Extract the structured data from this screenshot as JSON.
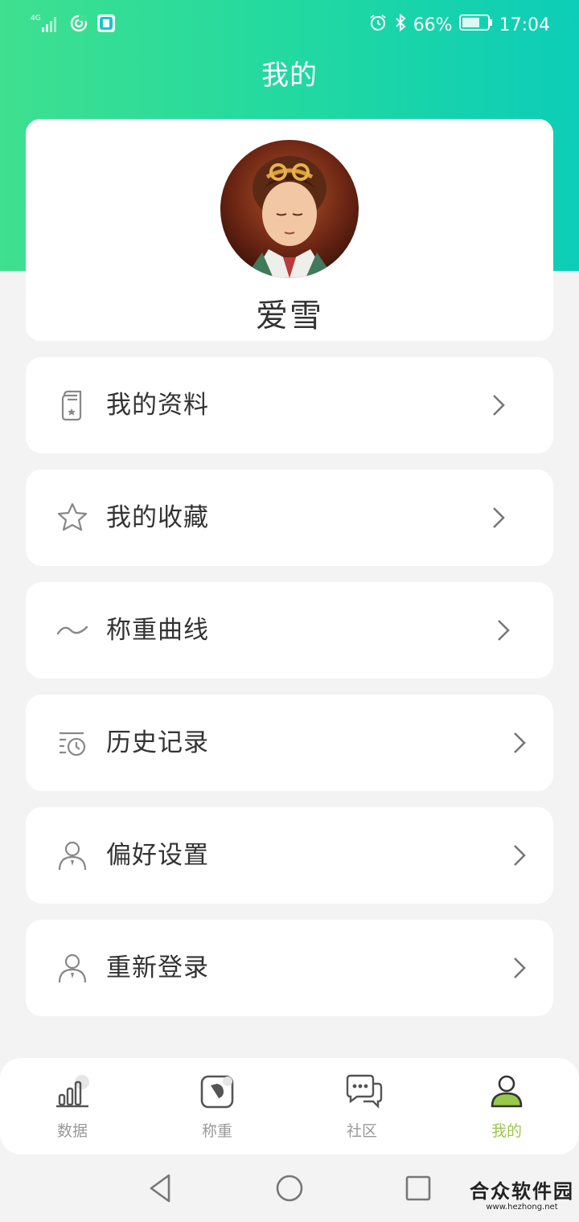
{
  "status_bar": {
    "network": "4G",
    "battery": "66%",
    "time": "17:04"
  },
  "header": {
    "title": "我的"
  },
  "profile": {
    "username": "爱雪"
  },
  "menu": [
    {
      "label": "我的资料",
      "icon": "profile-card-icon"
    },
    {
      "label": "我的收藏",
      "icon": "star-icon"
    },
    {
      "label": "称重曲线",
      "icon": "wave-curve-icon"
    },
    {
      "label": "历史记录",
      "icon": "history-clock-icon"
    },
    {
      "label": "偏好设置",
      "icon": "user-icon"
    },
    {
      "label": "重新登录",
      "icon": "user-icon"
    }
  ],
  "bottom_nav": [
    {
      "label": "数据",
      "icon": "bar-chart-icon",
      "active": false
    },
    {
      "label": "称重",
      "icon": "scale-icon",
      "active": false
    },
    {
      "label": "社区",
      "icon": "chat-bubbles-icon",
      "active": false
    },
    {
      "label": "我的",
      "icon": "person-icon",
      "active": true
    }
  ],
  "watermark": {
    "main": "合众软件园",
    "sub": "www.hezhong.net"
  },
  "colors": {
    "header_gradient_start": "#3fe08f",
    "header_gradient_end": "#0ccdb8",
    "active_tab": "#9ac84a",
    "inactive_tab": "#999999"
  }
}
